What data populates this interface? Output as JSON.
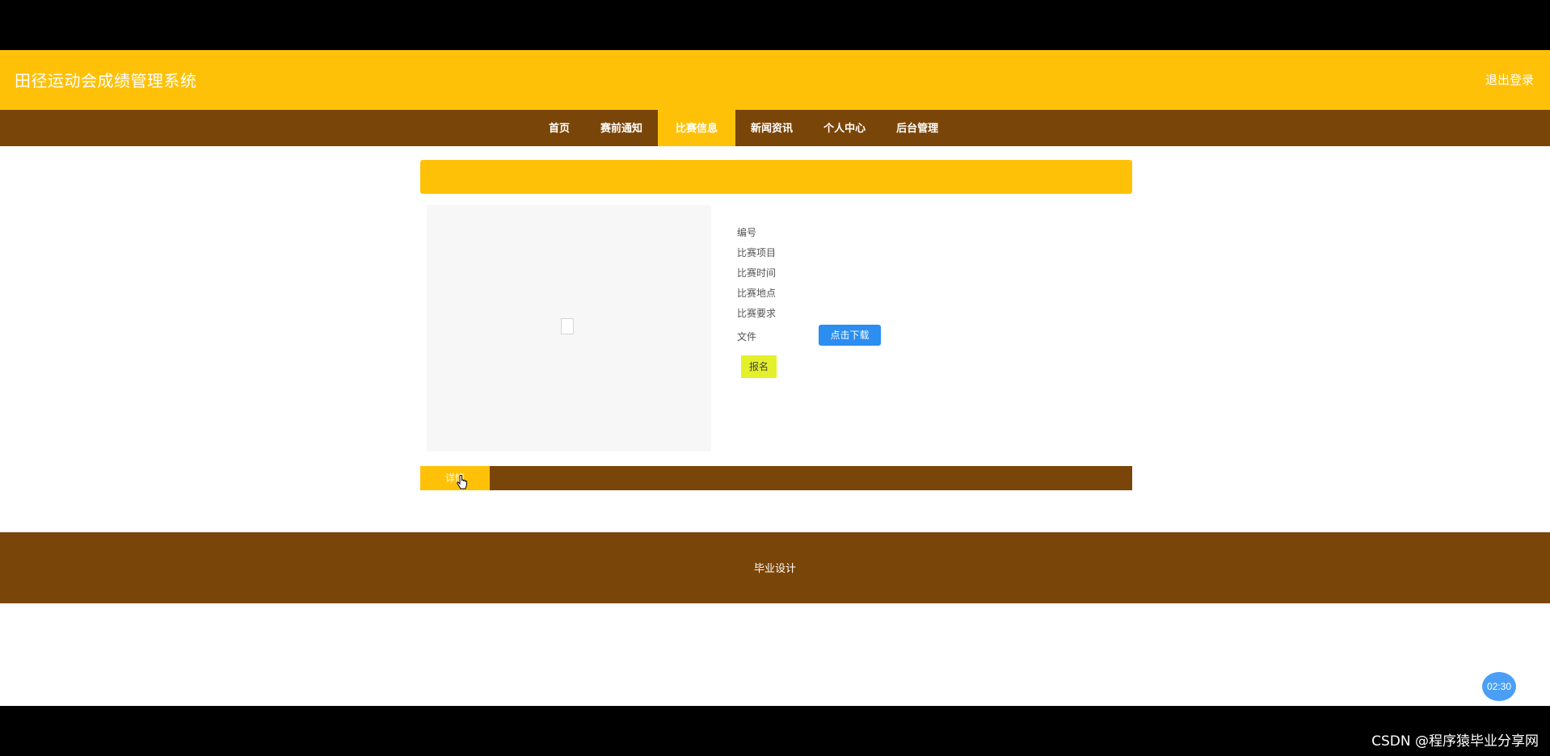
{
  "header": {
    "site_title": "田径运动会成绩管理系统",
    "top_link": "退出登录"
  },
  "nav": {
    "items": [
      {
        "label": "首页",
        "active": false
      },
      {
        "label": "赛前通知",
        "active": false
      },
      {
        "label": "比赛信息",
        "active": true
      },
      {
        "label": "新闻资讯",
        "active": false
      },
      {
        "label": "个人中心",
        "active": false
      },
      {
        "label": "后台管理",
        "active": false
      }
    ]
  },
  "detail": {
    "fields": [
      {
        "label": "编号",
        "value": ""
      },
      {
        "label": "比赛项目",
        "value": ""
      },
      {
        "label": "比赛时间",
        "value": ""
      },
      {
        "label": "比赛地点",
        "value": ""
      },
      {
        "label": "比赛要求",
        "value": ""
      }
    ],
    "file_label": "文件",
    "download_label": "点击下载",
    "signup_label": "报名"
  },
  "tabs": {
    "active_label": "详情"
  },
  "footer": {
    "text": "毕业设计"
  },
  "overlay": {
    "timer": "02:30",
    "watermark": "CSDN @程序猿毕业分享网"
  },
  "colors": {
    "primary": "#ffc107",
    "brown": "#7a4508",
    "download_button": "#2b8ef0",
    "signup_button": "#e4f02a"
  }
}
